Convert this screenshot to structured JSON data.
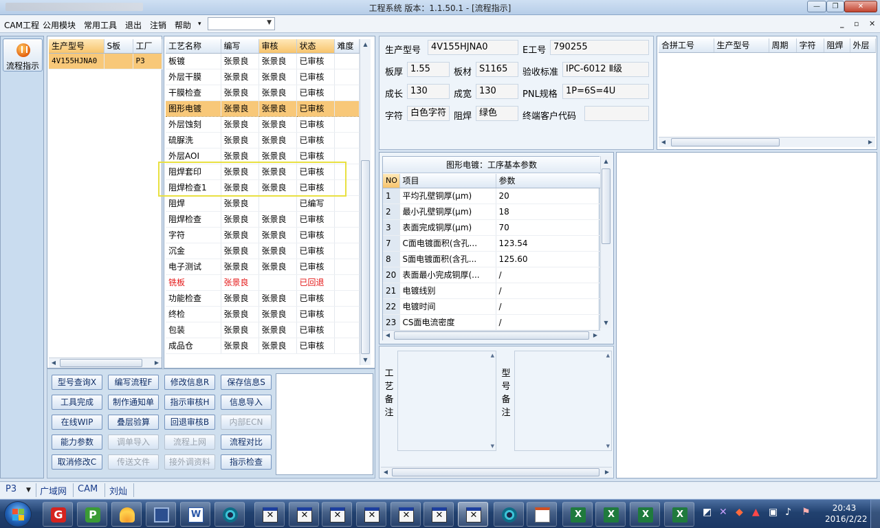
{
  "window": {
    "title": "工程系统   版本：1.1.50.1 - [流程指示]"
  },
  "menu": {
    "items": [
      "CAM工程",
      "公用模块",
      "常用工具",
      "退出",
      "注销",
      "帮助"
    ],
    "help_arrow": "▾",
    "combo_value": ""
  },
  "nav": {
    "flow_label": "流程指示"
  },
  "model_list": {
    "headers": [
      "生产型号",
      "S板",
      "工厂"
    ],
    "rows": [
      {
        "model": "4V155HJNA0",
        "s": "",
        "factory": "P3"
      }
    ]
  },
  "process": {
    "headers": [
      "工艺名称",
      "编写",
      "审核",
      "状态",
      "难度"
    ],
    "rows": [
      {
        "name": "板镀",
        "writer": "张景良",
        "reviewer": "张景良",
        "status": "已审核",
        "diff": ""
      },
      {
        "name": "外层干膜",
        "writer": "张景良",
        "reviewer": "张景良",
        "status": "已审核",
        "diff": ""
      },
      {
        "name": "干膜检查",
        "writer": "张景良",
        "reviewer": "张景良",
        "status": "已审核",
        "diff": ""
      },
      {
        "name": "图形电镀",
        "writer": "张景良",
        "reviewer": "张景良",
        "status": "已审核",
        "diff": ""
      },
      {
        "name": "外层蚀刻",
        "writer": "张景良",
        "reviewer": "张景良",
        "status": "已审核",
        "diff": ""
      },
      {
        "name": "硫脲洗",
        "writer": "张景良",
        "reviewer": "张景良",
        "status": "已审核",
        "diff": ""
      },
      {
        "name": "外层AOI",
        "writer": "张景良",
        "reviewer": "张景良",
        "status": "已审核",
        "diff": ""
      },
      {
        "name": "阻焊套印",
        "writer": "张景良",
        "reviewer": "张景良",
        "status": "已审核",
        "diff": ""
      },
      {
        "name": "阻焊检查1",
        "writer": "张景良",
        "reviewer": "张景良",
        "status": "已审核",
        "diff": ""
      },
      {
        "name": "阻焊",
        "writer": "张景良",
        "reviewer": "",
        "status": "已编写",
        "diff": ""
      },
      {
        "name": "阻焊检查",
        "writer": "张景良",
        "reviewer": "张景良",
        "status": "已审核",
        "diff": ""
      },
      {
        "name": "字符",
        "writer": "张景良",
        "reviewer": "张景良",
        "status": "已审核",
        "diff": ""
      },
      {
        "name": "沉金",
        "writer": "张景良",
        "reviewer": "张景良",
        "status": "已审核",
        "diff": ""
      },
      {
        "name": "电子测试",
        "writer": "张景良",
        "reviewer": "张景良",
        "status": "已审核",
        "diff": ""
      },
      {
        "name": "铣板",
        "writer": "张景良",
        "reviewer": "",
        "status": "已回退",
        "diff": ""
      },
      {
        "name": "功能检查",
        "writer": "张景良",
        "reviewer": "张景良",
        "status": "已审核",
        "diff": ""
      },
      {
        "name": "终检",
        "writer": "张景良",
        "reviewer": "张景良",
        "status": "已审核",
        "diff": ""
      },
      {
        "name": "包装",
        "writer": "张景良",
        "reviewer": "张景良",
        "status": "已审核",
        "diff": ""
      },
      {
        "name": "成品仓",
        "writer": "张景良",
        "reviewer": "张景良",
        "status": "已审核",
        "diff": ""
      }
    ]
  },
  "buttons": [
    [
      "型号查询X",
      "编写流程F",
      "修改信息R",
      "保存信息S"
    ],
    [
      "工具完成",
      "制作通知单",
      "指示审核H",
      "信息导入"
    ],
    [
      "在线WIP",
      "叠层验算",
      "回退审核B",
      "内部ECN"
    ],
    [
      "能力参数",
      "调单导入",
      "流程上网",
      "流程对比"
    ],
    [
      "取消修改C",
      "传送文件",
      "接外调资料",
      "指示检查"
    ]
  ],
  "info": {
    "model_label": "生产型号",
    "model_value": "4V155HJNA0",
    "eno_label": "E工号",
    "eno_value": "790255",
    "thick_label": "板厚",
    "thick_value": "1.55",
    "material_label": "板材",
    "material_value": "S1165",
    "standard_label": "验收标准",
    "standard_value": "IPC-6012 Ⅱ级",
    "length_label": "成长",
    "length_value": "130",
    "width_label": "成宽",
    "width_value": "130",
    "pnl_label": "PNL规格",
    "pnl_value": "1P=6S=4U",
    "char_label": "字符",
    "char_value": "白色字符",
    "mask_label": "阻焊",
    "mask_value": "绿色",
    "customer_label": "终端客户代码",
    "customer_value": ""
  },
  "combine": {
    "headers": [
      "合拼工号",
      "生产型号",
      "周期",
      "字符",
      "阻焊",
      "外层"
    ]
  },
  "params": {
    "title": "图形电镀：工序基本参数",
    "headers": [
      "NO",
      "项目",
      "参数"
    ],
    "rows": [
      {
        "no": "1",
        "item": "平均孔壁铜厚(μm)",
        "value": "20"
      },
      {
        "no": "2",
        "item": "最小孔壁铜厚(μm)",
        "value": "18"
      },
      {
        "no": "3",
        "item": "表面完成铜厚(μm)",
        "value": "70"
      },
      {
        "no": "7",
        "item": "C面电镀面积(含孔...",
        "value": "123.54"
      },
      {
        "no": "8",
        "item": "S面电镀面积(含孔...",
        "value": "125.60"
      },
      {
        "no": "20",
        "item": "表面最小完成铜厚(...",
        "value": "/"
      },
      {
        "no": "21",
        "item": "电镀线别",
        "value": "/"
      },
      {
        "no": "22",
        "item": "电镀时间",
        "value": "/"
      },
      {
        "no": "23",
        "item": "CS面电流密度",
        "value": "/"
      }
    ]
  },
  "notes": {
    "process_label": "工艺备注",
    "model_label": "型号备注"
  },
  "status": {
    "factory": "P3",
    "net": "广域网",
    "module": "CAM",
    "user": "刘灿"
  },
  "clock": {
    "time": "20:43",
    "date": "2016/2/22"
  }
}
